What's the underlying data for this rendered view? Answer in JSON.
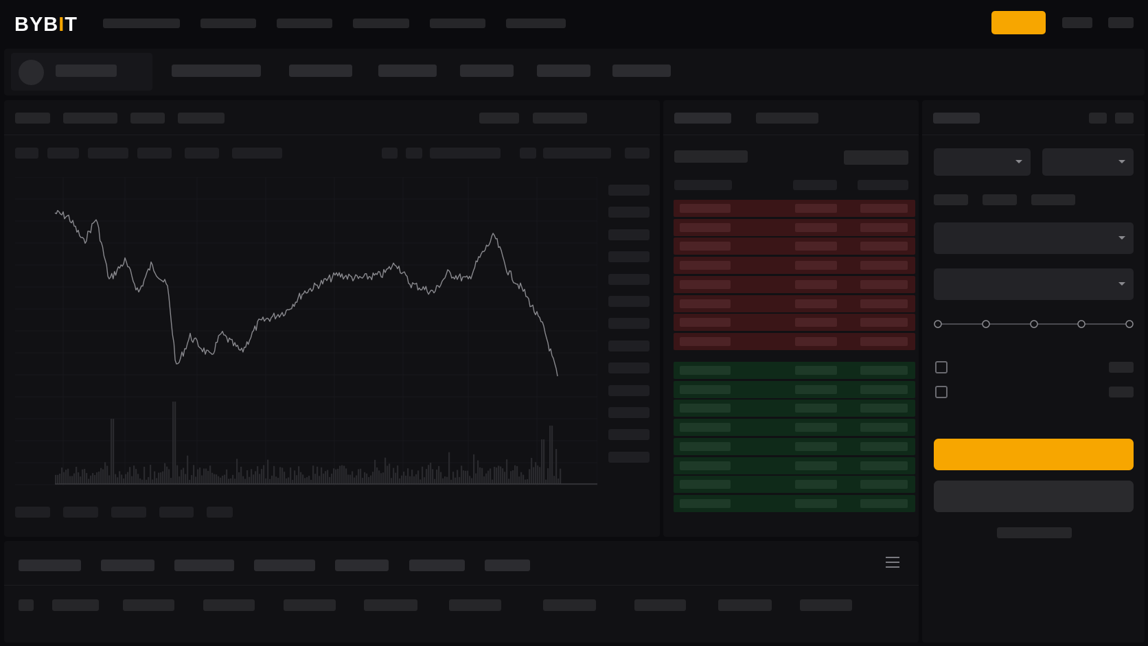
{
  "header": {
    "logo_text": "BYB",
    "logo_accent": "I",
    "logo_tail": "T",
    "brand_color": "#f7a600"
  },
  "colors": {
    "ask_bg": "#3a1517",
    "bid_bg": "#0f2a19",
    "accent": "#f7a600",
    "price_line": "#8a8a8f"
  },
  "icons": {
    "menu": "hamburger-menu-icon",
    "dropdown": "chevron-down-icon"
  },
  "order_book": {
    "ask_rows": 8,
    "bid_rows": 8
  },
  "order_form": {
    "leverage_slider_position": 0
  }
}
